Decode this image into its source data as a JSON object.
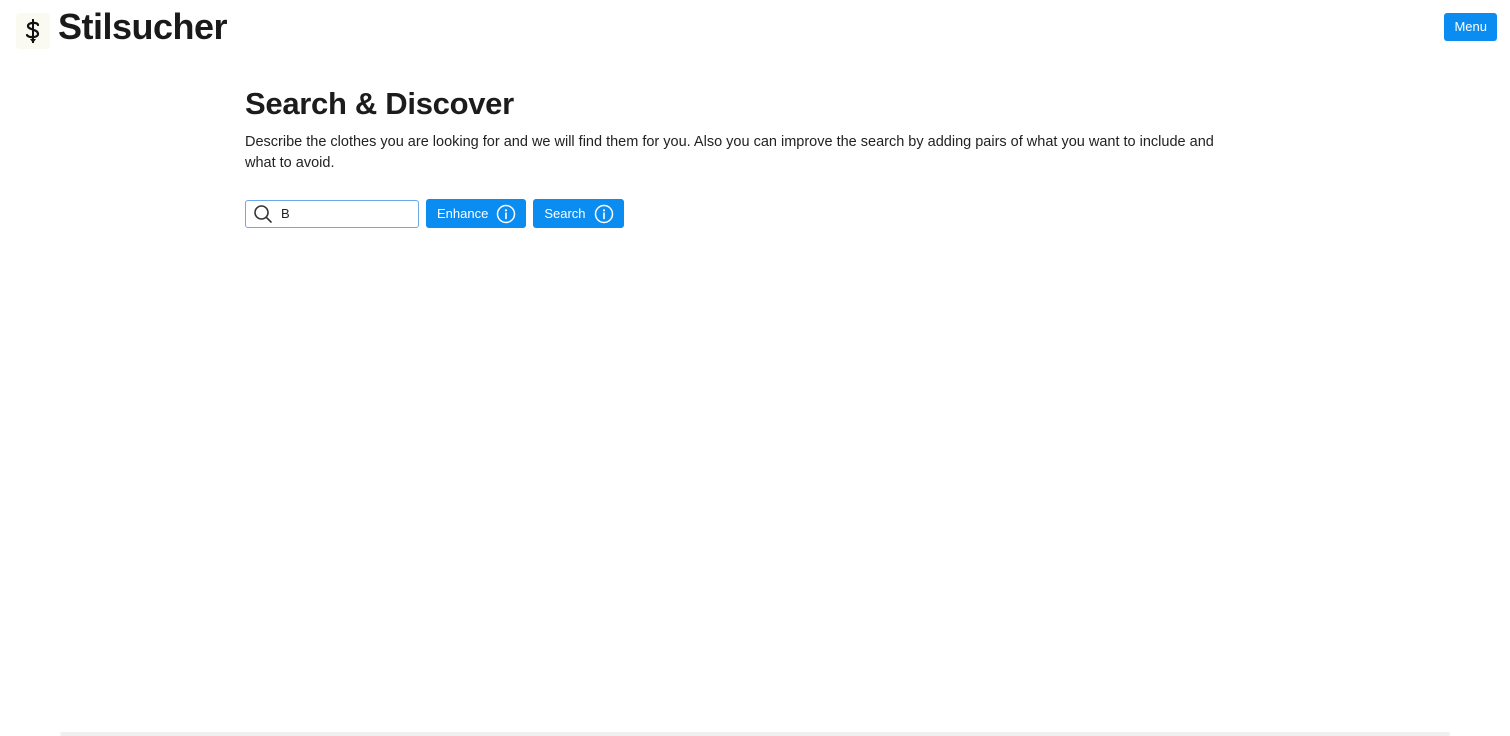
{
  "header": {
    "brand": "Stilsucher",
    "menu_label": "Menu",
    "logo_icon": "dollar-sign-icon"
  },
  "main": {
    "title": "Search & Discover",
    "description": "Describe the clothes you are looking for and we will find them for you. Also you can improve the search by adding pairs of what you want to include and what to avoid."
  },
  "search": {
    "value": "B",
    "icon": "search-icon"
  },
  "buttons": {
    "enhance_label": "Enhance",
    "search_label": "Search",
    "info_icon": "info-icon"
  },
  "colors": {
    "accent": "#0a8cf0",
    "input_border": "#6aa8e6"
  }
}
